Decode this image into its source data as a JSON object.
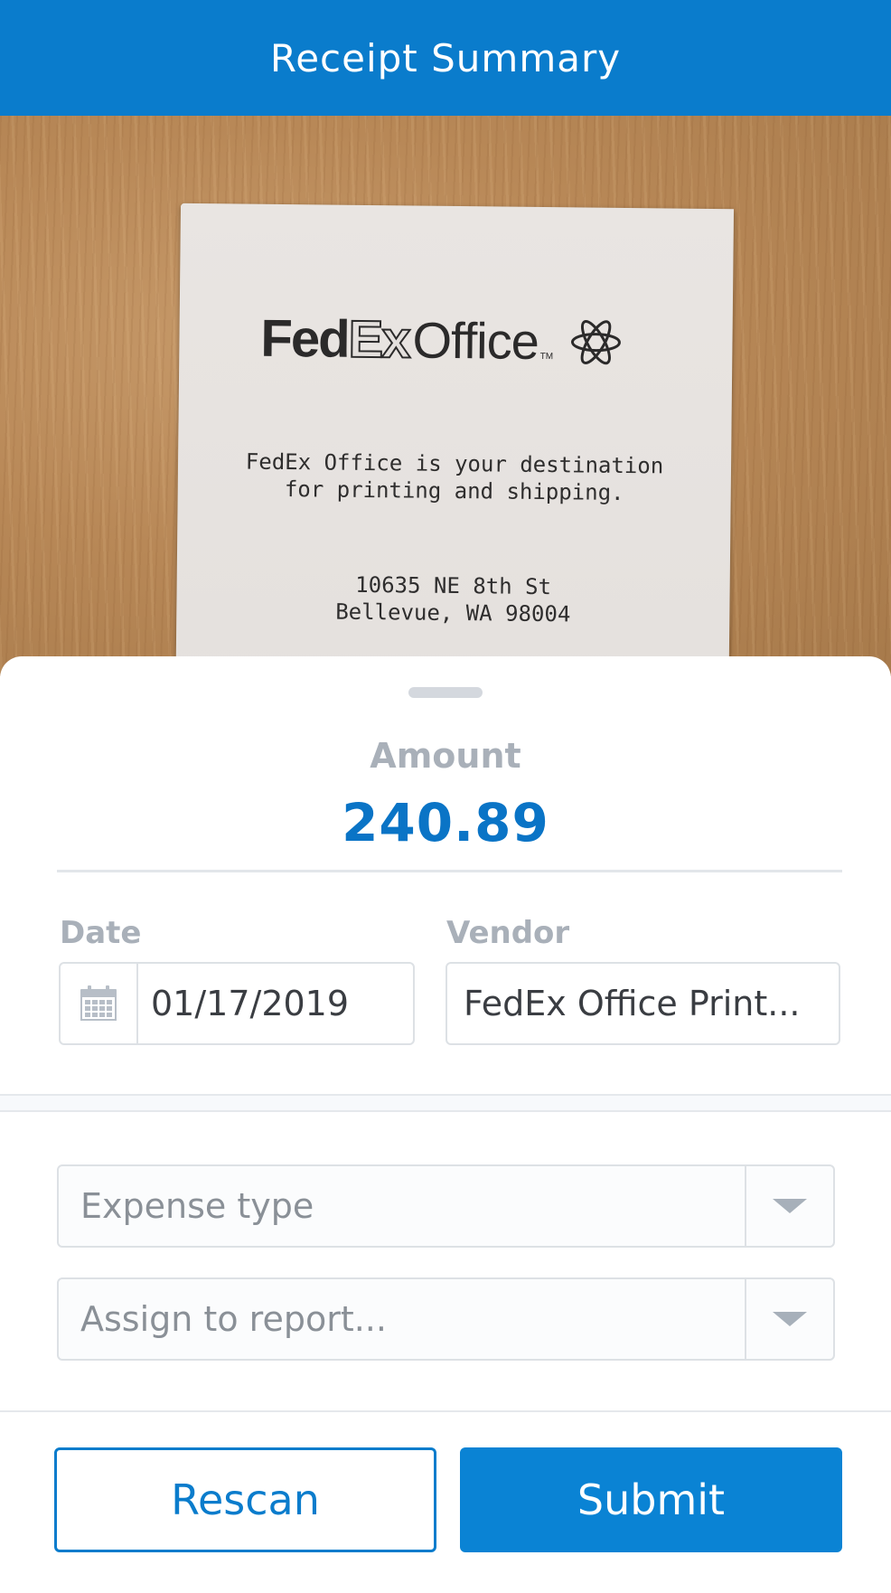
{
  "header": {
    "title": "Receipt Summary"
  },
  "receipt_image": {
    "logo_parts": {
      "fed": "Fed",
      "ex": "Ex",
      "office": "Office",
      "tm": "TM"
    },
    "tagline_line1": "FedEx Office is your destination",
    "tagline_line2": "for printing and shipping.",
    "address_line1": "10635 NE 8th St",
    "address_line2": "Bellevue, WA 98004"
  },
  "summary": {
    "amount_label": "Amount",
    "amount_value": "240.89",
    "date_label": "Date",
    "date_value": "01/17/2019",
    "vendor_label": "Vendor",
    "vendor_value": "FedEx Office Print..."
  },
  "expense_type": {
    "placeholder": "Expense type"
  },
  "report": {
    "placeholder": "Assign to report..."
  },
  "actions": {
    "rescan_label": "Rescan",
    "submit_label": "Submit"
  },
  "icons": {
    "date": "calendar-icon",
    "dropdown": "chevron-down-icon"
  },
  "colors": {
    "brand": "#0a7ccc",
    "amount": "#0a74c6",
    "label": "#a9b0b9"
  }
}
